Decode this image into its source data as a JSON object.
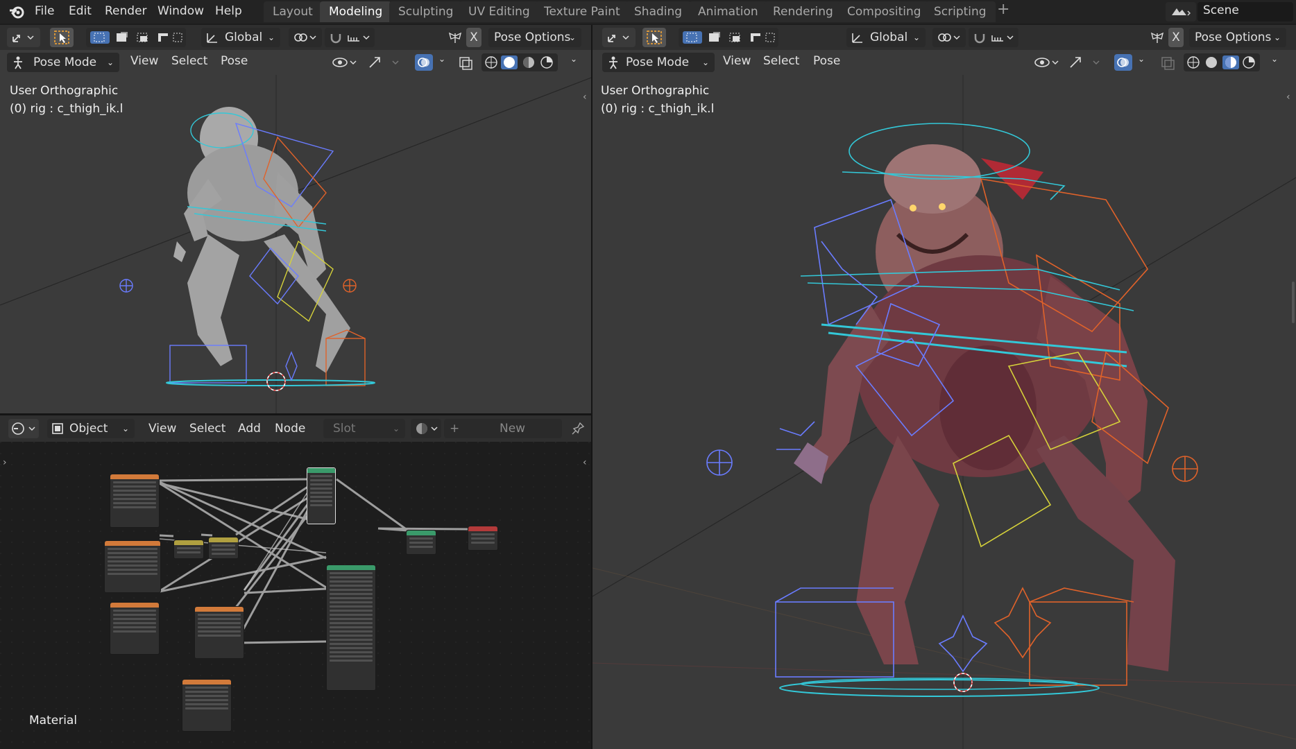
{
  "topbar": {
    "menus": [
      "File",
      "Edit",
      "Render",
      "Window",
      "Help"
    ],
    "workspaces": [
      "Layout",
      "Modeling",
      "Sculpting",
      "UV Editing",
      "Texture Paint",
      "Shading",
      "Animation",
      "Rendering",
      "Compositing",
      "Scripting"
    ],
    "active_workspace": "Modeling",
    "add_tab": "+",
    "scene_name": "Scene"
  },
  "viewport_left": {
    "transform_orientation": "Global",
    "pose_options": "Pose Options",
    "mirror_x": "X",
    "mode": "Pose Mode",
    "menus": [
      "View",
      "Select",
      "Pose"
    ],
    "view_name": "User Orthographic",
    "active_object": "(0) rig : c_thigh_ik.l"
  },
  "viewport_right": {
    "transform_orientation": "Global",
    "pose_options": "Pose Options",
    "mirror_x": "X",
    "mode": "Pose Mode",
    "menus": [
      "View",
      "Select",
      "Pose"
    ],
    "view_name": "User Orthographic",
    "active_object": "(0) rig : c_thigh_ik.l"
  },
  "node_editor": {
    "object_type": "Object",
    "menus": [
      "View",
      "Select",
      "Add",
      "Node"
    ],
    "slot": "Slot",
    "new_button": "New",
    "plus": "+",
    "context_label": "Material"
  },
  "colors": {
    "accent": "#4772b3",
    "active_select": "#ffaa33",
    "bone_cyan": "#33c8d8",
    "bone_orange": "#e0622a",
    "bone_blue": "#6a7cff",
    "bone_yellow": "#d6d23a"
  }
}
